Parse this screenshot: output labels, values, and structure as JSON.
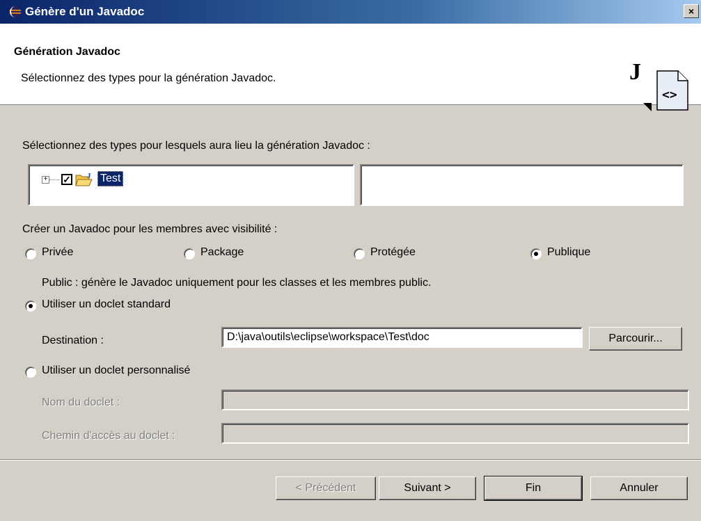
{
  "window": {
    "title": "Génère d'un Javadoc",
    "close_label": "×"
  },
  "header": {
    "title": "Génération Javadoc",
    "description": "Sélectionnez des types pour la génération Javadoc."
  },
  "types_section": {
    "label": "Sélectionnez des types pour lesquels aura lieu la génération Javadoc :",
    "tree": [
      {
        "label": "Test",
        "checked": true,
        "expanded": false,
        "selected": true
      }
    ]
  },
  "visibility": {
    "label": "Créer un Javadoc pour les membres avec visibilité :",
    "options": [
      {
        "label": "Privée",
        "selected": false
      },
      {
        "label": "Package",
        "selected": false
      },
      {
        "label": "Protégée",
        "selected": false
      },
      {
        "label": "Publique",
        "selected": true
      }
    ],
    "description": "Public : génère le Javadoc uniquement pour les classes et les membres public."
  },
  "standard_doclet": {
    "label": "Utiliser un doclet standard",
    "selected": true,
    "destination_label": "Destination :",
    "destination_value": "D:\\java\\outils\\eclipse\\workspace\\Test\\doc",
    "browse_label": "Parcourir..."
  },
  "custom_doclet": {
    "label": "Utiliser un doclet personnalisé",
    "selected": false,
    "name_label": "Nom du doclet :",
    "name_value": "",
    "path_label": "Chemin d'accès au doclet :",
    "path_value": ""
  },
  "buttons": {
    "previous": "< Précédent",
    "next": "Suivant >",
    "finish": "Fin",
    "cancel": "Annuler"
  },
  "colors": {
    "titlebar": "#0a246a",
    "dialog_bg": "#d4d0c8",
    "selection": "#0a246a"
  }
}
